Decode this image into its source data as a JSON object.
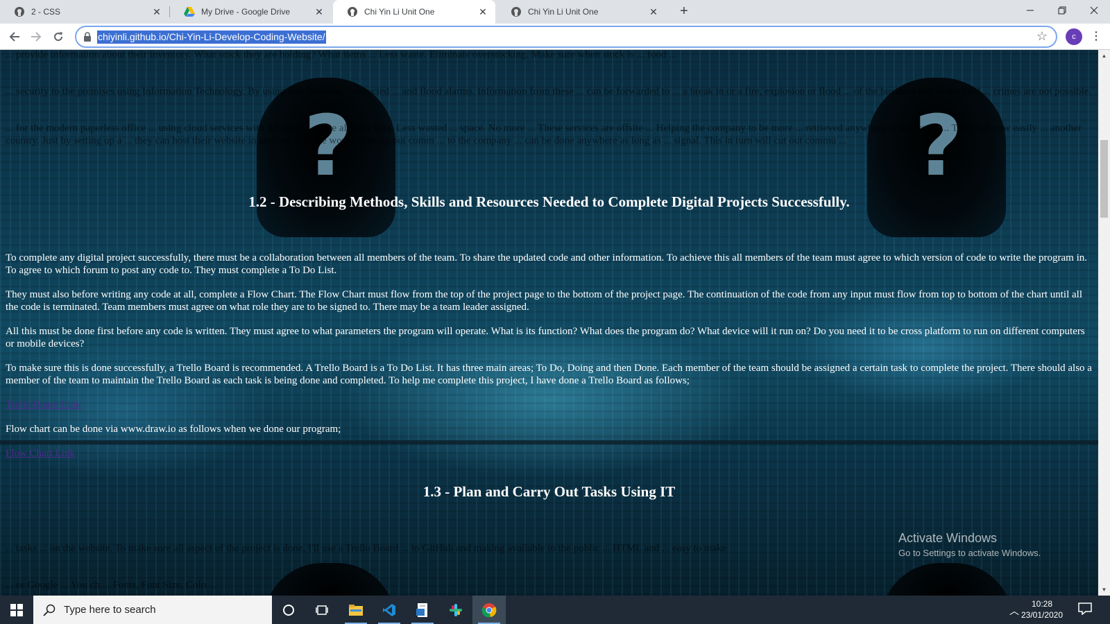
{
  "browser": {
    "tabs": [
      {
        "title": "2 - CSS",
        "icon": "github-icon",
        "active": false
      },
      {
        "title": "My Drive - Google Drive",
        "icon": "google-drive-icon",
        "active": false
      },
      {
        "title": "Chi Yin Li Unit One",
        "icon": "github-icon",
        "active": true
      },
      {
        "title": "Chi Yin Li Unit One",
        "icon": "github-icon",
        "active": false
      }
    ],
    "new_tab_symbol": "+",
    "url": "chiyinli.github.io/Chi-Yin-Li-Develop-Coding-Website/",
    "profile_initial": "c",
    "accent_color": "#3b6fd3"
  },
  "page": {
    "faded_paragraphs": [
      "... provide information about their inventory. What stock they are holding? What items ... Less waste. Eliminate overstocking. Make sure when stock is ... food ...",
      "... security to the premises using Information Technology. By using web cameras, connected ... and flood alarms. Information from these ... can be forwarded to ... a break in or a fire, explosion or flood ... of the business can be notified ... crimes are not possible.",
      "... for the modern paperless office ... using cloud services with Amazon ... share all their data. Less wasted ... space. No more ... These services are offsite ... Helping the company to be more ... retrieved anywhere in the world ... They can now easily ... another country. Just by setting up a ... they can host their website in another ... in the world. Cutting out comm ... to the company ... can be done anywhere as long as ... signal. This in turn will cut out commu ..."
    ],
    "heading_1_2": "1.2 - Describing Methods, Skills and Resources Needed to Complete Digital Projects Successfully.",
    "paragraphs_1_2": [
      "To complete any digital project successfully, there must be a collaboration between all members of the team. To share the updated code and other information. To achieve this all members of the team must agree to which version of code to write the program in. To agree to which forum to post any code to. They must complete a To Do List.",
      "They must also before writing any code at all, complete a Flow Chart. The Flow Chart must flow from the top of the project page to the bottom of the project page. The continuation of the code from any input must flow from top to bottom of the chart until all the code is terminated. Team members must agree on what role they are to be signed to. There may be a team leader assigned.",
      "All this must be done first before any code is written. They must agree to what parameters the program will operate. What is its function? What does the program do? What device will it run on? Do you need it to be cross platform to run on different computers or mobile devices?",
      "To make sure this is done successfully, a Trello Board is recommended. A Trello Board is a To Do List. It has three main areas; To Do, Doing and then Done. Each member of the team should be assigned a certain task to complete the project. There should also a member of the team to maintain the Trello Board as each task is being done and completed. To help me complete this project, I have done a Trello Board as follows;"
    ],
    "trello_link": "Trello Board Link",
    "flowchart_text": "Flow chart can be done via www.draw.io as follows when we done our program;",
    "flowchart_link": "Flow Chart Link",
    "heading_1_3": "1.3 - Plan and Carry Out Tasks Using IT",
    "faded_paragraph_1_3": "... tasks ... on the website. To make sure all aspect of the project is done, I'll use a Trello Board ... to GitHub and making available to the public ... HTML and ... easy to make",
    "faded_paragraph_1_3b": "... or Google ... You ch ... Fonts, Font Size, Colo ..."
  },
  "watermark": {
    "line1": "Activate Windows",
    "line2": "Go to Settings to activate Windows."
  },
  "taskbar": {
    "search_placeholder": "Type here to search",
    "time": "10:28",
    "date": "23/01/2020",
    "apps": [
      "cortana-icon",
      "task-view-icon",
      "file-explorer-icon",
      "vscode-icon",
      "file-app-icon",
      "slack-icon",
      "chrome-icon"
    ]
  }
}
